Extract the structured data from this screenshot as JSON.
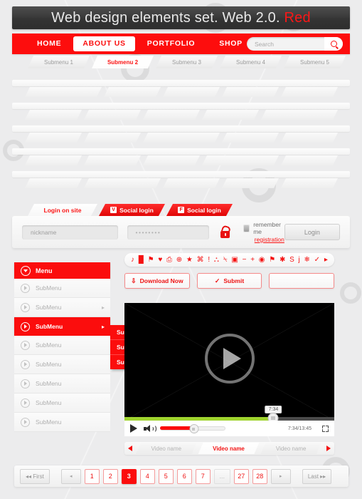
{
  "title_bar": {
    "text_main": "Web design elements set. Web 2.0. ",
    "text_accent": "Red",
    "accent_color": "#fb1717"
  },
  "theme": {
    "red": "#fb0d0d",
    "red_dark": "#e00707",
    "grey_bg": "#ececed",
    "green_progress": "#9fd42e"
  },
  "nav": {
    "items": [
      {
        "label": "HOME",
        "active": false
      },
      {
        "label": "ABOUT US",
        "active": true
      },
      {
        "label": "PORTFOLIO",
        "active": false
      },
      {
        "label": "SHOP",
        "active": false
      }
    ],
    "search": {
      "placeholder": "Search",
      "value": "",
      "icon": "search-icon"
    }
  },
  "subtabs": [
    {
      "label": "Submenu 1",
      "active": false
    },
    {
      "label": "Submenu 2",
      "active": true
    },
    {
      "label": "Submenu 3",
      "active": false
    },
    {
      "label": "Submenu 4",
      "active": false
    },
    {
      "label": "Submenu 5",
      "active": false
    }
  ],
  "content_rows": [
    {
      "segments": [
        108,
        80,
        80,
        80,
        80
      ]
    },
    {
      "segments": [
        80,
        80,
        80,
        80,
        108
      ]
    },
    {
      "segments": [
        80,
        80,
        108,
        80,
        80
      ]
    },
    {
      "segments": [
        80,
        80,
        80,
        108,
        80
      ]
    },
    {
      "segments": [
        80,
        108,
        80,
        80,
        80
      ]
    }
  ],
  "login": {
    "tabs": [
      {
        "label": "Login on site",
        "type": "site",
        "active": true,
        "badge": ""
      },
      {
        "label": "Social login",
        "type": "social",
        "active": false,
        "badge": "V"
      },
      {
        "label": "Social login",
        "type": "social",
        "active": false,
        "badge": "F"
      }
    ],
    "username": {
      "placeholder": "nickname",
      "value": ""
    },
    "password": {
      "placeholder": "••••••••",
      "value": "••••••••"
    },
    "lock_icon": "unlock-icon",
    "remember_label": "remember me",
    "remember_checked": false,
    "registration_label": "registration",
    "login_button": "Login"
  },
  "sidebar": {
    "header": {
      "label": "Menu",
      "icon": "chevron-down-circle-icon"
    },
    "items": [
      {
        "label": "SubMenu",
        "active": false,
        "has_arrow": false
      },
      {
        "label": "SubMenu",
        "active": false,
        "has_arrow": true
      },
      {
        "label": "SubMenu",
        "active": true,
        "has_arrow": true
      },
      {
        "label": "SubMenu",
        "active": false,
        "has_arrow": false
      },
      {
        "label": "SubMenu",
        "active": false,
        "has_arrow": false
      },
      {
        "label": "SubMenu",
        "active": false,
        "has_arrow": false
      },
      {
        "label": "SubMenu",
        "active": false,
        "has_arrow": false
      },
      {
        "label": "SubMenu",
        "active": false,
        "has_arrow": false
      }
    ],
    "flyout": [
      {
        "label": "SubMenu"
      },
      {
        "label": "SubMenu"
      },
      {
        "label": "SubMenu"
      }
    ]
  },
  "icon_bar": [
    {
      "name": "music-note-icon",
      "glyph": "♪"
    },
    {
      "name": "bar-chart-icon",
      "glyph": "█"
    },
    {
      "name": "tag-icon",
      "glyph": "⚑"
    },
    {
      "name": "heart-icon",
      "glyph": "♥"
    },
    {
      "name": "printer-icon",
      "glyph": "⎙"
    },
    {
      "name": "globe-icon",
      "glyph": "⊕"
    },
    {
      "name": "star-icon",
      "glyph": "★"
    },
    {
      "name": "video-camera-icon",
      "glyph": "⌘"
    },
    {
      "name": "exclamation-icon",
      "glyph": "!"
    },
    {
      "name": "user-icon",
      "glyph": "⛬"
    },
    {
      "name": "trash-icon",
      "glyph": "⍀"
    },
    {
      "name": "save-icon",
      "glyph": "▣"
    },
    {
      "name": "minus-icon",
      "glyph": "−"
    },
    {
      "name": "plus-icon",
      "glyph": "+"
    },
    {
      "name": "eye-icon",
      "glyph": "◉"
    },
    {
      "name": "pushpin-icon",
      "glyph": "⚑"
    },
    {
      "name": "asterisk-icon",
      "glyph": "✱"
    },
    {
      "name": "dollar-icon",
      "glyph": "S"
    },
    {
      "name": "info-icon",
      "glyph": "j"
    },
    {
      "name": "snowflake-icon",
      "glyph": "❄"
    },
    {
      "name": "check-icon",
      "glyph": "✓"
    },
    {
      "name": "arrow-right-icon",
      "glyph": "▸"
    }
  ],
  "action_buttons": [
    {
      "label": "Download Now",
      "icon": "download-icon",
      "glyph": "⇩"
    },
    {
      "label": "Submit",
      "icon": "check-icon",
      "glyph": "✓"
    },
    {
      "label": "",
      "icon": "",
      "glyph": ""
    }
  ],
  "player": {
    "play_icon": "play-icon",
    "volume_icon": "speaker-icon",
    "fullscreen_icon": "fullscreen-icon",
    "tooltip_time": "7:34",
    "time_display": "7:34/13:45",
    "progress_percent": 71,
    "volume_percent": 52
  },
  "video_tabs": {
    "prev_icon": "arrow-left-icon",
    "next_icon": "arrow-right-icon",
    "items": [
      {
        "label": "Video name",
        "active": false
      },
      {
        "label": "Video name",
        "active": true
      },
      {
        "label": "Video name",
        "active": false
      }
    ]
  },
  "pagination": {
    "first_label": "◂◂ First",
    "prev_label": "◂",
    "next_label": "▸",
    "last_label": "Last ▸▸",
    "ellipsis": "...",
    "pages": [
      {
        "label": "1",
        "active": false
      },
      {
        "label": "2",
        "active": false
      },
      {
        "label": "3",
        "active": true
      },
      {
        "label": "4",
        "active": false
      },
      {
        "label": "5",
        "active": false
      },
      {
        "label": "6",
        "active": false
      },
      {
        "label": "7",
        "active": false
      }
    ],
    "tail_pages": [
      {
        "label": "27",
        "active": false
      },
      {
        "label": "28",
        "active": false
      }
    ]
  }
}
